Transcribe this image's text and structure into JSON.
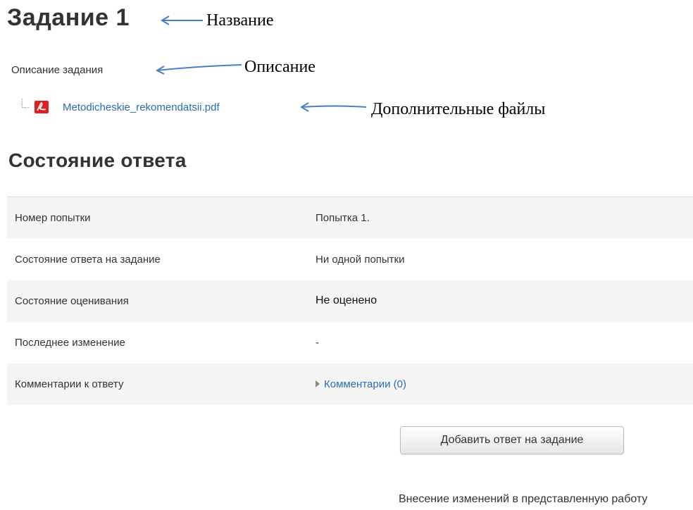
{
  "assignment": {
    "title": "Задание 1",
    "description": "Описание задания",
    "file": {
      "name": "Metodicheskie_rekomendatsii.pdf",
      "icon": "pdf-icon"
    }
  },
  "annotations": {
    "title": "Название",
    "description": "Описание",
    "files": "Дополнительные файлы",
    "arrow_color": "#4a7fc1"
  },
  "submission_status": {
    "heading": "Состояние ответа",
    "rows": [
      {
        "label": "Номер попытки",
        "value": "Попытка 1."
      },
      {
        "label": "Состояние ответа на задание",
        "value": "Ни одной попытки"
      },
      {
        "label": "Состояние оценивания",
        "value": "Не оценено"
      },
      {
        "label": "Последнее изменение",
        "value": "-"
      },
      {
        "label": "Комментарии к ответу",
        "value": "Комментарии (0)"
      }
    ]
  },
  "actions": {
    "add_submission": "Добавить ответ на задание",
    "edit_note": "Внесение изменений в представленную работу"
  },
  "colors": {
    "link": "#2a6cb4",
    "row_alt": "#f5f5f5",
    "text": "#333333"
  }
}
